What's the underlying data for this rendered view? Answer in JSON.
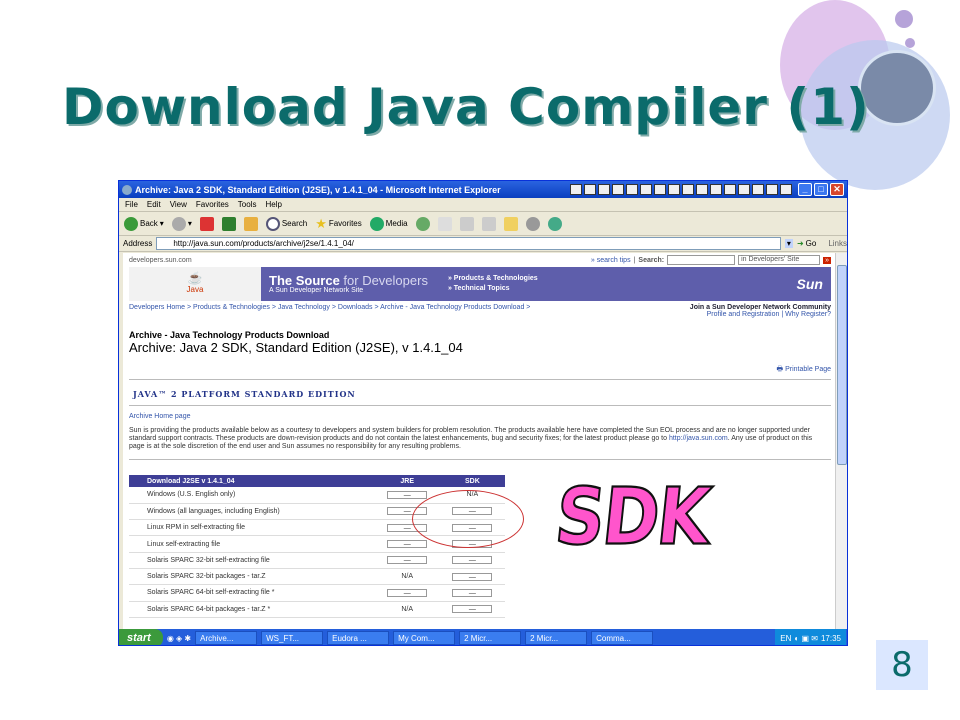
{
  "slide": {
    "title": "Download Java Compiler (1)",
    "page_number": "8",
    "annotation": "SDK"
  },
  "browser": {
    "title": "Archive: Java 2 SDK, Standard Edition (J2SE), v 1.4.1_04 - Microsoft Internet Explorer",
    "menu": [
      "File",
      "Edit",
      "View",
      "Favorites",
      "Tools",
      "Help"
    ],
    "toolbar": {
      "back": "Back",
      "search": "Search",
      "favorites": "Favorites",
      "media": "Media"
    },
    "address_label": "Address",
    "url": "http://java.sun.com/products/archive/j2se/1.4.1_04/",
    "go": "Go",
    "links": "Links"
  },
  "page": {
    "site": "developers.sun.com",
    "search_tips": "» search tips",
    "search_label": "Search:",
    "search_scope": "in Developers' Site",
    "banner": {
      "logo_text": "Java",
      "title_strong": "The Source",
      "title_rest": " for Developers",
      "subtitle": "A Sun Developer Network Site",
      "link1": "» Products & Technologies",
      "link2": "» Technical Topics",
      "brand": "Sun"
    },
    "breadcrumb": "Developers Home > Products & Technologies > Java Technology > Downloads > Archive - Java Technology Products Download >",
    "join_text": "Join a Sun Developer Network Community",
    "profile_text": "Profile and Registration | Why Register?",
    "heading_small": "Archive - Java Technology Products Download",
    "heading_big": "Archive: Java 2 SDK, Standard Edition (J2SE), v 1.4.1_04",
    "printable": "Printable Page",
    "edition": "JAVA™ 2 PLATFORM STANDARD EDITION",
    "archive_home": "Archive Home page",
    "paragraph_a": "Sun is providing the products available below as a courtesy to developers and system builders for problem resolution. The products available here have completed the Sun EOL process and are no longer supported under standard support contracts. These products are down-revision products and do not contain the latest enhancements, bug and security fixes; for the latest product please go to ",
    "paragraph_link": "http://java.sun.com",
    "paragraph_b": ". Any use of product on this page is at the sole discretion of the end user and Sun assumes no responsibility for any resulting problems.",
    "table": {
      "headers": [
        "Download J2SE v 1.4.1_04",
        "JRE",
        "SDK"
      ],
      "rows": [
        {
          "name": "Windows (U.S. English only)",
          "jre": "—",
          "sdk": "N/A"
        },
        {
          "name": "Windows (all languages, including English)",
          "jre": "—",
          "sdk": "—"
        },
        {
          "name": "Linux RPM in self-extracting file",
          "jre": "—",
          "sdk": "—"
        },
        {
          "name": "Linux self-extracting file",
          "jre": "—",
          "sdk": "—"
        },
        {
          "name": "Solaris SPARC 32-bit self-extracting file",
          "jre": "—",
          "sdk": "—"
        },
        {
          "name": "Solaris SPARC 32-bit packages - tar.Z",
          "jre": "N/A",
          "sdk": "—"
        },
        {
          "name": "Solaris SPARC 64-bit self-extracting file *",
          "jre": "—",
          "sdk": "—"
        },
        {
          "name": "Solaris SPARC 64-bit packages - tar.Z *",
          "jre": "N/A",
          "sdk": "—"
        }
      ]
    }
  },
  "taskbar": {
    "start": "start",
    "tasks": [
      "Archive...",
      "WS_FT...",
      "Eudora ...",
      "My Com...",
      "2 Micr...",
      "2 Micr...",
      "Comma..."
    ],
    "lang": "EN",
    "clock": "17:35"
  }
}
